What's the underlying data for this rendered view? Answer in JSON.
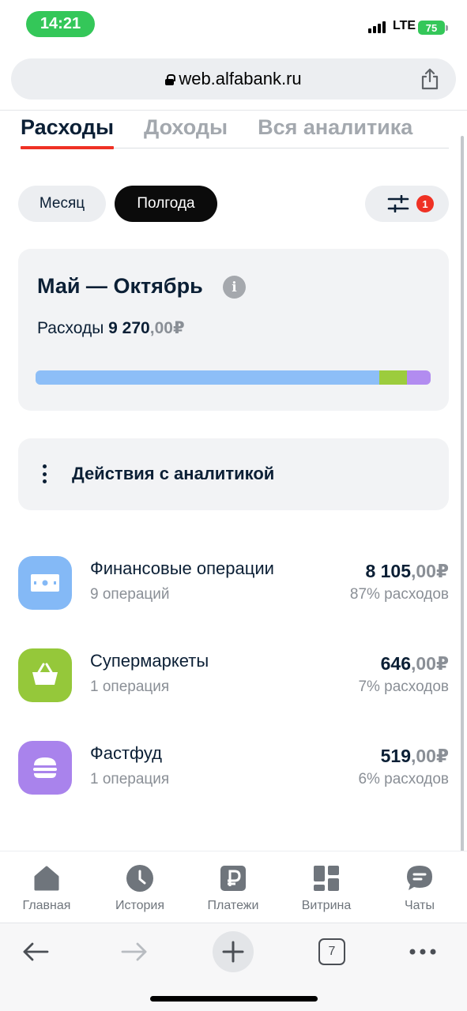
{
  "status_bar": {
    "time": "14:21",
    "network": "LTE",
    "battery": "75"
  },
  "browser": {
    "url": "web.alfabank.ru",
    "open_tabs": "7"
  },
  "tabs": [
    {
      "label": "Расходы",
      "active": true
    },
    {
      "label": "Доходы",
      "active": false
    },
    {
      "label": "Вся аналитика",
      "active": false
    }
  ],
  "period": {
    "month_label": "Месяц",
    "half_year_label": "Полгода",
    "selected": "Полгода"
  },
  "filter": {
    "badge_count": "1"
  },
  "summary": {
    "title": "Май — Октябрь",
    "label": "Расходы",
    "amount_main": "9 270",
    "amount_fraction": ",00",
    "currency": "₽",
    "bar_segments": [
      {
        "category": "Финансовые операции",
        "share": 0.87,
        "color": "#8dbef7"
      },
      {
        "category": "Супермаркеты",
        "share": 0.07,
        "color": "#9ccc3d"
      },
      {
        "category": "Фастфуд",
        "share": 0.06,
        "color": "#b28cf0"
      }
    ]
  },
  "actions": {
    "label": "Действия с аналитикой"
  },
  "categories": [
    {
      "name": "Финансовые операции",
      "operations": "9 операций",
      "amount_main": "8 105",
      "amount_fraction": ",00",
      "currency": "₽",
      "share": "87% расходов",
      "icon": "banknote-icon",
      "color": "#84b9f6"
    },
    {
      "name": "Супермаркеты",
      "operations": "1 операция",
      "amount_main": "646",
      "amount_fraction": ",00",
      "currency": "₽",
      "share": "7% расходов",
      "icon": "basket-icon",
      "color": "#95c83a"
    },
    {
      "name": "Фастфуд",
      "operations": "1 операция",
      "amount_main": "519",
      "amount_fraction": ",00",
      "currency": "₽",
      "share": "6% расходов",
      "icon": "burger-icon",
      "color": "#a983ec"
    }
  ],
  "bottom_nav": [
    {
      "label": "Главная",
      "icon": "home-icon"
    },
    {
      "label": "История",
      "icon": "clock-icon"
    },
    {
      "label": "Платежи",
      "icon": "ruble-icon"
    },
    {
      "label": "Витрина",
      "icon": "grid-icon"
    },
    {
      "label": "Чаты",
      "icon": "chat-icon"
    }
  ],
  "colors": {
    "accent_red": "#ef3124",
    "text_primary": "#0b1f35",
    "text_secondary": "#8a8f96",
    "card_bg": "#f2f3f5"
  }
}
